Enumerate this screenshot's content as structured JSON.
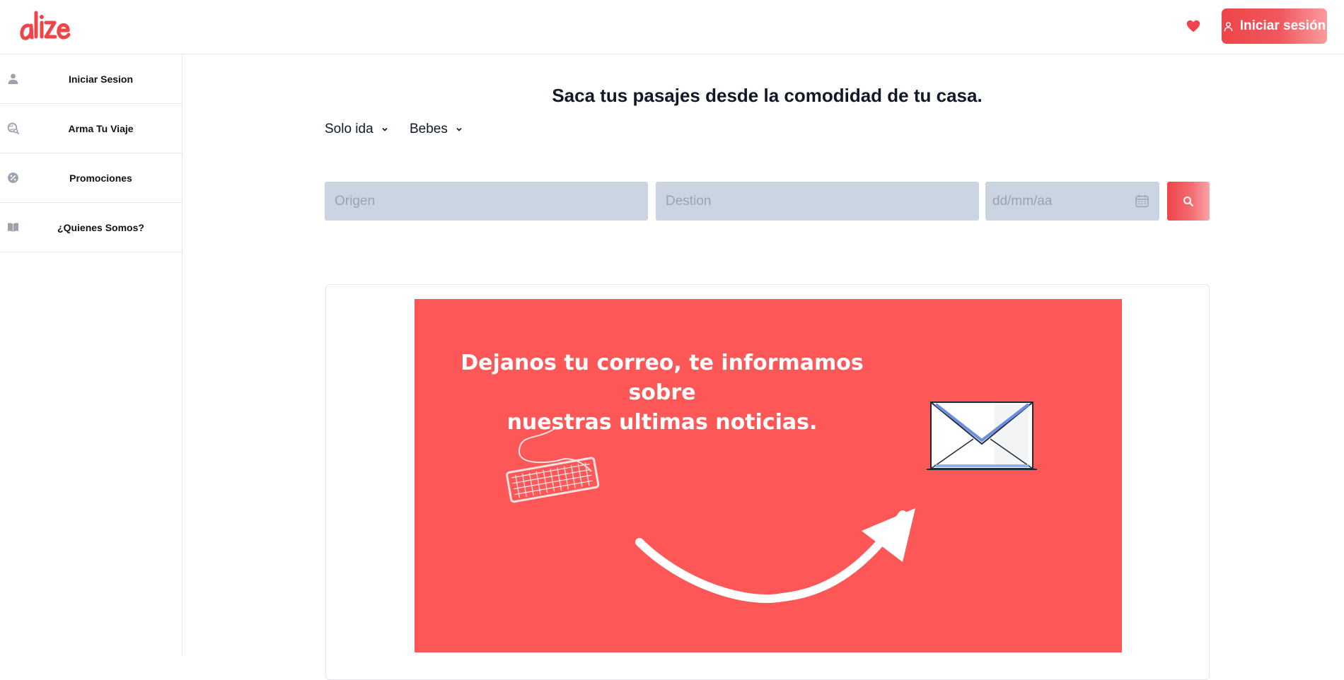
{
  "header": {
    "logo_text": "alize",
    "login_label": "Iniciar sesión",
    "brand_color": "#ef4449"
  },
  "sidebar": {
    "items": [
      {
        "label": "Iniciar Sesion",
        "icon": "user-icon"
      },
      {
        "label": "Arma Tu Viaje",
        "icon": "globe-search-icon"
      },
      {
        "label": "Promociones",
        "icon": "discount-badge-icon"
      },
      {
        "label": "¿Quienes Somos?",
        "icon": "book-open-icon"
      }
    ]
  },
  "main": {
    "headline": "Saca tus pasajes desde la comodidad de tu casa.",
    "trip_type": "Solo ida",
    "passengers": "Bebes",
    "origin_placeholder": "Origen",
    "destination_placeholder": "Destion",
    "date_placeholder": "dd/mm/aa"
  },
  "banner": {
    "text_line1": "Dejanos tu correo, te informamos sobre",
    "text_line2": "nuestras ultimas noticias.",
    "background": "#fe5757"
  }
}
